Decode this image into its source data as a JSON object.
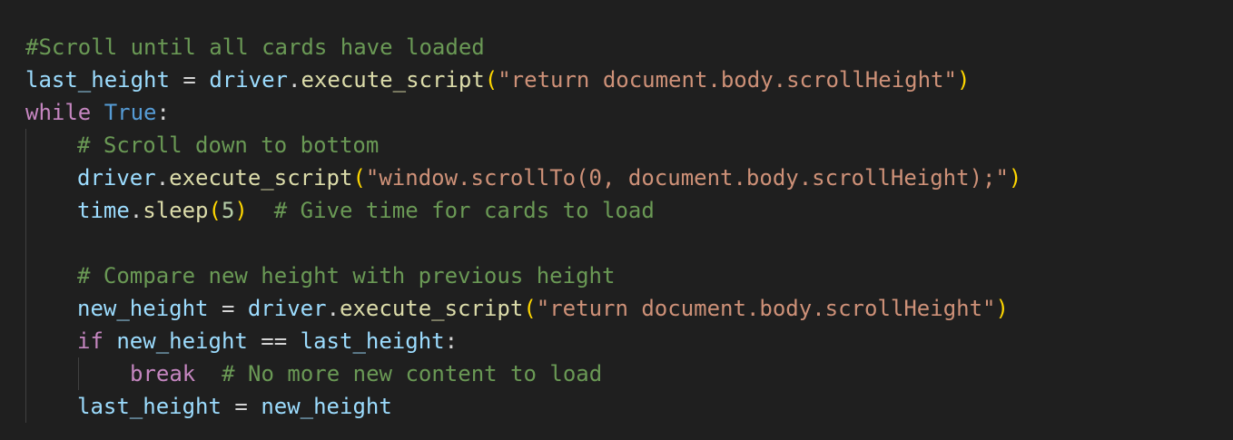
{
  "editor": {
    "language": "python",
    "theme_background": "#1f1f1f",
    "lines": [
      {
        "tokens": [
          {
            "type": "comment",
            "text": "#Scroll until all cards have loaded"
          }
        ]
      },
      {
        "tokens": [
          {
            "type": "variable",
            "text": "last_height"
          },
          {
            "type": "operator",
            "text": " = "
          },
          {
            "type": "variable",
            "text": "driver"
          },
          {
            "type": "operator",
            "text": "."
          },
          {
            "type": "function",
            "text": "execute_script"
          },
          {
            "type": "paren",
            "text": "("
          },
          {
            "type": "string",
            "text": "\"return document.body.scrollHeight\""
          },
          {
            "type": "paren",
            "text": ")"
          }
        ]
      },
      {
        "tokens": [
          {
            "type": "keyword",
            "text": "while"
          },
          {
            "type": "operator",
            "text": " "
          },
          {
            "type": "boolean",
            "text": "True"
          },
          {
            "type": "operator",
            "text": ":"
          }
        ]
      },
      {
        "tokens": [
          {
            "type": "comment",
            "text": "# Scroll down to bottom"
          }
        ]
      },
      {
        "tokens": [
          {
            "type": "variable",
            "text": "driver"
          },
          {
            "type": "operator",
            "text": "."
          },
          {
            "type": "function",
            "text": "execute_script"
          },
          {
            "type": "paren",
            "text": "("
          },
          {
            "type": "string",
            "text": "\"window.scrollTo(0, document.body.scrollHeight);\""
          },
          {
            "type": "paren",
            "text": ")"
          }
        ]
      },
      {
        "tokens": [
          {
            "type": "variable",
            "text": "time"
          },
          {
            "type": "operator",
            "text": "."
          },
          {
            "type": "function",
            "text": "sleep"
          },
          {
            "type": "paren",
            "text": "("
          },
          {
            "type": "number",
            "text": "5"
          },
          {
            "type": "paren",
            "text": ")"
          },
          {
            "type": "operator",
            "text": "  "
          },
          {
            "type": "comment",
            "text": "# Give time for cards to load"
          }
        ]
      },
      {
        "tokens": []
      },
      {
        "tokens": [
          {
            "type": "comment",
            "text": "# Compare new height with previous height"
          }
        ]
      },
      {
        "tokens": [
          {
            "type": "variable",
            "text": "new_height"
          },
          {
            "type": "operator",
            "text": " = "
          },
          {
            "type": "variable",
            "text": "driver"
          },
          {
            "type": "operator",
            "text": "."
          },
          {
            "type": "function",
            "text": "execute_script"
          },
          {
            "type": "paren",
            "text": "("
          },
          {
            "type": "string",
            "text": "\"return document.body.scrollHeight\""
          },
          {
            "type": "paren",
            "text": ")"
          }
        ]
      },
      {
        "tokens": [
          {
            "type": "keyword",
            "text": "if"
          },
          {
            "type": "operator",
            "text": " "
          },
          {
            "type": "variable",
            "text": "new_height"
          },
          {
            "type": "operator",
            "text": " == "
          },
          {
            "type": "variable",
            "text": "last_height"
          },
          {
            "type": "operator",
            "text": ":"
          }
        ]
      },
      {
        "tokens": [
          {
            "type": "keyword",
            "text": "break"
          },
          {
            "type": "operator",
            "text": "  "
          },
          {
            "type": "comment",
            "text": "# No more new content to load"
          }
        ]
      },
      {
        "tokens": [
          {
            "type": "variable",
            "text": "last_height"
          },
          {
            "type": "operator",
            "text": " = "
          },
          {
            "type": "variable",
            "text": "new_height"
          }
        ]
      }
    ]
  }
}
